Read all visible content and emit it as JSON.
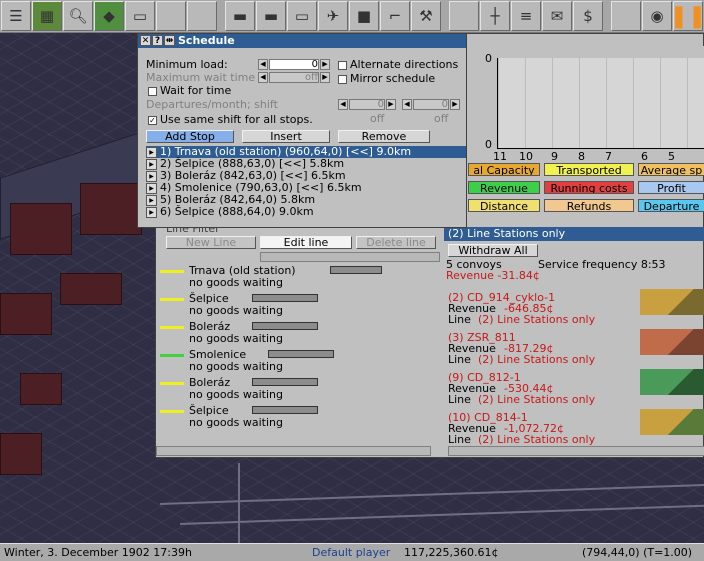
{
  "toolbar": {
    "buttons": [
      "menu-icon",
      "map-icon",
      "zoom-icon",
      "terrain-icon",
      "train-icon",
      "tool-icon",
      "tool-icon",
      "road-icon",
      "tram-icon",
      "ship-icon",
      "air-icon",
      "maglev-icon",
      "crane-icon",
      "rail-tool-icon",
      "blank",
      "tracks-icon",
      "list-icon",
      "mailbox-icon",
      "finance-icon",
      "blank",
      "camera-icon",
      "pause-icon"
    ]
  },
  "schedule_window": {
    "title": "Schedule",
    "min_load_label": "Minimum load:",
    "min_load_value": "0",
    "max_wait_label": "Maximum wait time",
    "max_wait_value": "off",
    "wait_for_time_label": "Wait for time",
    "departures_label": "Departures/month; shift",
    "departures_value_1": "0",
    "departures_value_2": "0",
    "off_1": "off",
    "off_2": "off",
    "use_same_shift_label": "Use same shift for all stops.",
    "alternate_label": "Alternate directions",
    "mirror_label": "Mirror schedule",
    "add_stop": "Add Stop",
    "insert": "Insert",
    "remove": "Remove",
    "entries": [
      "1) Trnava (old station) (960,64,0) [<<] 9.0km",
      "2) Šelpice (888,63,0) [<<] 5.8km",
      "3) Boleráz (842,63,0) [<<] 6.5km",
      "4) Smolenice (790,63,0) [<<] 6.5km",
      "5) Boleráz (842,64,0) 5.8km",
      "6) Šelpice (888,64,0) 9.0km"
    ]
  },
  "line_window": {
    "chart_axis_top": "0",
    "chart_axis_bottom": "0",
    "chart_x_ticks": [
      "11",
      "10",
      "9",
      "8",
      "7",
      "6",
      "5"
    ],
    "chips": [
      {
        "label": "al Capacity",
        "color": "#e7a832"
      },
      {
        "label": "Transported",
        "color": "#f0f050"
      },
      {
        "label": "Average sp",
        "color": "#f0c060"
      },
      {
        "label": "Revenue",
        "color": "#3cd04a"
      },
      {
        "label": "Running costs",
        "color": "#e04040"
      },
      {
        "label": "Profit",
        "color": "#a8c8f0"
      },
      {
        "label": "Distance",
        "color": "#f0e070"
      },
      {
        "label": "Refunds",
        "color": "#f0c890"
      },
      {
        "label": "Departure",
        "color": "#58c8f0"
      }
    ],
    "line_name_label": "Line Filter",
    "line_header": "(2) Line Stations only",
    "new_line": "New Line",
    "edit_line": "Edit line",
    "delete_line": "Delete line",
    "withdraw_all": "Withdraw All",
    "convoys_count": "5 convoys",
    "service_frequency": "Service frequency 8:53",
    "total_revenue": "Revenue -31.84¢",
    "stations": [
      {
        "name": "Trnava (old station)",
        "status": "no goods waiting",
        "color": "#f0f020"
      },
      {
        "name": "Šelpice",
        "status": "no goods waiting",
        "color": "#f0f020"
      },
      {
        "name": "Boleráz",
        "status": "no goods waiting",
        "color": "#f0f020"
      },
      {
        "name": "Smolenice",
        "status": "no goods waiting",
        "color": "#40d040"
      },
      {
        "name": "Boleráz",
        "status": "no goods waiting",
        "color": "#f0f020"
      },
      {
        "name": "Šelpice",
        "status": "no goods waiting",
        "color": "#f0f020"
      }
    ],
    "convoys": [
      {
        "name": "(2) CD_914_cyklo-1",
        "revenue": "-646.85¢",
        "line": "(2) Line Stations only"
      },
      {
        "name": "(3) ZSR_811",
        "revenue": "-817.29¢",
        "line": "(2) Line Stations only"
      },
      {
        "name": "(9) CD_812-1",
        "revenue": "-530.44¢",
        "line": "(2) Line Stations only"
      },
      {
        "name": "(10) CD_814-1",
        "revenue": "-1,072.72¢",
        "line": "(2) Line Stations only"
      }
    ],
    "revenue_label": "Revenue",
    "line_label": "Line"
  },
  "statusbar": {
    "date": "Winter, 3. December 1902 17:39h",
    "player": "Default player",
    "money": "117,225,360.61¢",
    "coords": "(794,44,0) (T=1.00)"
  },
  "colors": {
    "titlebar": "#2f5d93",
    "window_bg": "#c0c0c0",
    "negative": "#c81818"
  }
}
